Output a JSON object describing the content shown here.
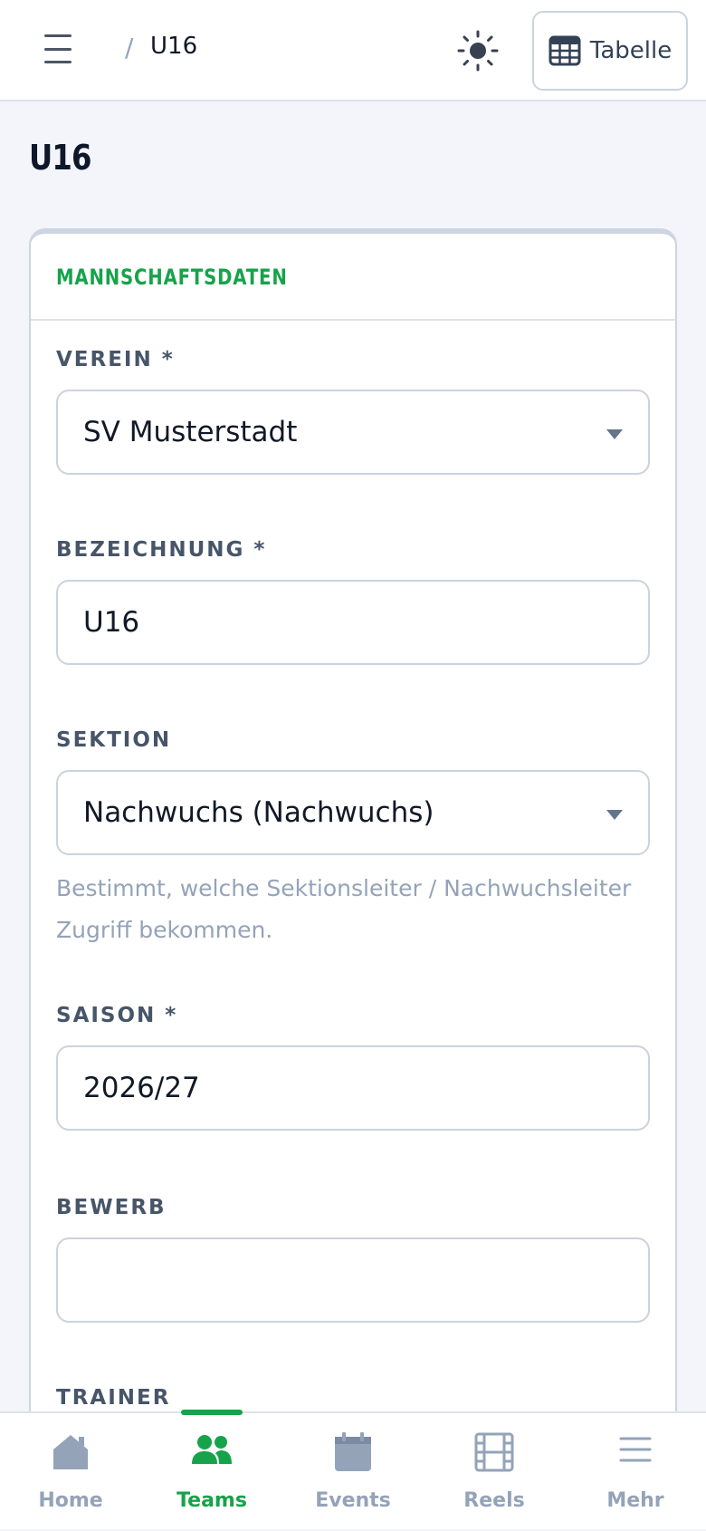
{
  "header": {
    "breadcrumb_separator": "/",
    "breadcrumb_current": "U16",
    "table_button_label": "Tabelle",
    "icons": {
      "menu": "hamburger-icon",
      "theme": "sun-icon",
      "table": "table-grid-icon"
    }
  },
  "page": {
    "title": "U16"
  },
  "card": {
    "title": "MANNSCHAFTSDATEN",
    "fields": [
      {
        "label": "VEREIN *",
        "value": "SV Musterstadt",
        "type": "select"
      },
      {
        "label": "BEZEICHNUNG *",
        "value": "U16",
        "type": "text"
      },
      {
        "label": "SEKTION",
        "value": "Nachwuchs (Nachwuchs)",
        "type": "select",
        "hint_line1": "Bestimmt, welche Sektionsleiter / Nachwuchsleiter",
        "hint_line2": "Zugriff bekommen."
      },
      {
        "label": "SAISON *",
        "value": "2026/27",
        "type": "text"
      },
      {
        "label": "BEWERB",
        "value": "",
        "type": "text"
      },
      {
        "label": "TRAINER"
      }
    ]
  },
  "bottom_nav": {
    "items": [
      {
        "label": "Home",
        "icon": "home-icon"
      },
      {
        "label": "Teams",
        "icon": "users-icon",
        "active": true
      },
      {
        "label": "Events",
        "icon": "calendar-icon"
      },
      {
        "label": "Reels",
        "icon": "film-icon"
      },
      {
        "label": "Mehr",
        "icon": "more-menu-icon"
      }
    ]
  },
  "colors": {
    "accent": "#16a34a",
    "muted": "#94a3b8",
    "border": "#cbd3de",
    "background": "#f3f5fa"
  }
}
